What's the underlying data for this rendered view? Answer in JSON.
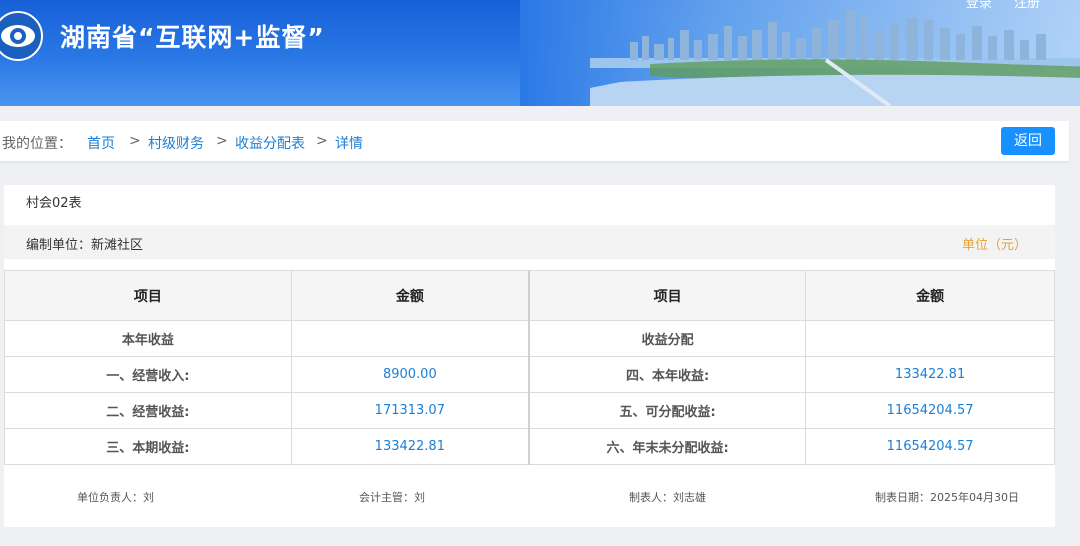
{
  "header": {
    "site_title": "湖南省“互联网+监督”",
    "links": [
      "登录",
      "注册"
    ]
  },
  "breadcrumb": {
    "location_label": "我的位置：",
    "items": [
      "首页",
      "村级财务",
      "收益分配表",
      "详情"
    ],
    "separator": ">",
    "back_label": "返回"
  },
  "report": {
    "form_code": "村会02表",
    "org": "编制单位：新滩社区",
    "unit": "单位（元）",
    "columns": [
      "项目",
      "金额",
      "项目",
      "金额"
    ],
    "rows": [
      {
        "left_item": "本年收益",
        "left_amount": "",
        "right_item": "收益分配",
        "right_amount": ""
      },
      {
        "left_item": "一、经营收入:",
        "left_amount": "8900.00",
        "right_item": "四、本年收益:",
        "right_amount": "133422.81"
      },
      {
        "left_item": "二、经营收益:",
        "left_amount": "171313.07",
        "right_item": "五、可分配收益:",
        "right_amount": "11654204.57"
      },
      {
        "left_item": "三、本期收益:",
        "left_amount": "133422.81",
        "right_item": "六、年末未分配收益:",
        "right_amount": "11654204.57"
      }
    ],
    "signatures": {
      "unit_head": "单位负责人：刘",
      "accountant": "会计主管：刘",
      "preparer": "制表人：刘志雄",
      "date": "制表日期：2025年04月30日"
    }
  },
  "colors": {
    "banner": "#2a78e6",
    "link": "#1a7fd6",
    "button": "#1890ff",
    "unit": "#e6a23c"
  }
}
